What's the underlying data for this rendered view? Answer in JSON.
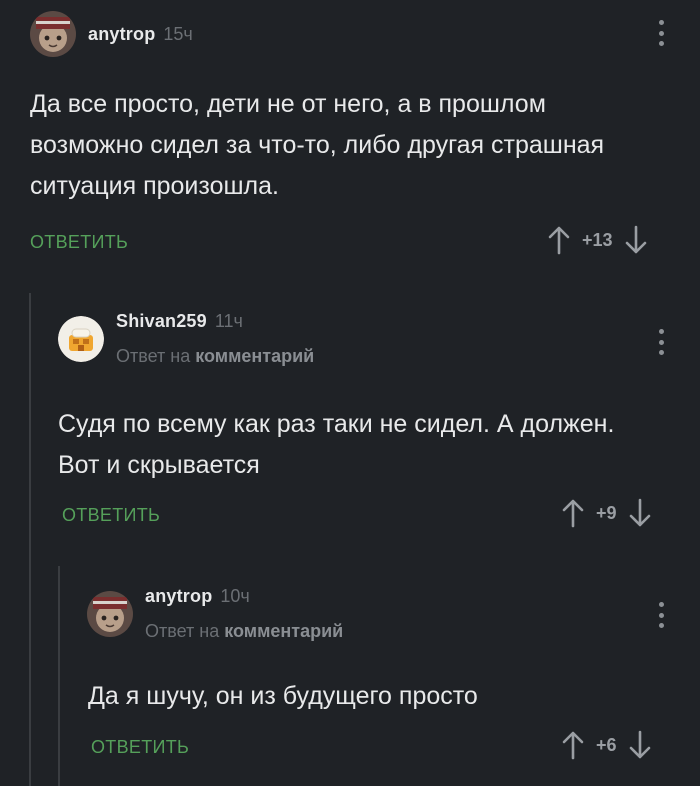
{
  "comments": [
    {
      "author": "anytrop",
      "time": "15ч",
      "text": "Да все просто, дети не от него, а в прошлом возможно сидел за что-то, либо другая страшная ситуация произошла.",
      "reply_label": "ОТВЕТИТЬ",
      "rating": "+13"
    },
    {
      "author": "Shivan259",
      "time": "11ч",
      "reply_prefix": "Ответ на",
      "reply_target": "комментарий",
      "text": "Судя по всему как раз таки не сидел. А должен. Вот и скрывается",
      "reply_label": "ОТВЕТИТЬ",
      "rating": "+9"
    },
    {
      "author": "anytrop",
      "time": "10ч",
      "reply_prefix": "Ответ на",
      "reply_target": "комментарий",
      "text": "Да я шучу, он из будущего просто",
      "reply_label": "ОТВЕТИТЬ",
      "rating": "+6"
    }
  ],
  "colors": {
    "background": "#1f2226",
    "reply_accent": "#55a05a",
    "muted": "#6b6f74"
  },
  "icons": {
    "upvote": "arrow-up-icon",
    "downvote": "arrow-down-icon",
    "more": "more-vertical-icon"
  }
}
